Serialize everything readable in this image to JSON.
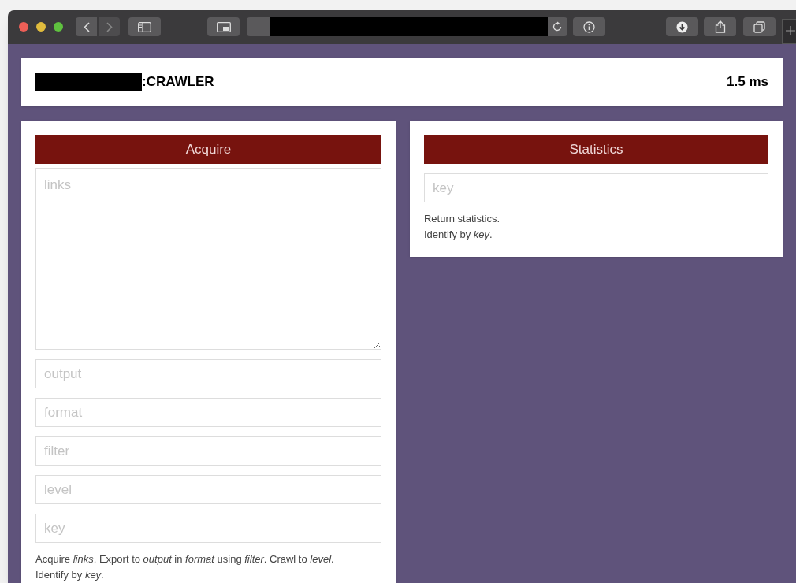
{
  "header": {
    "title": ":CRAWLER",
    "timing": "1.5 ms"
  },
  "panels": [
    {
      "heading": "Acquire",
      "fields": [
        {
          "kind": "textarea",
          "placeholder": "links"
        },
        {
          "kind": "input",
          "placeholder": "output"
        },
        {
          "kind": "input",
          "placeholder": "format"
        },
        {
          "kind": "input",
          "placeholder": "filter"
        },
        {
          "kind": "input",
          "placeholder": "level"
        },
        {
          "kind": "input",
          "placeholder": "key"
        }
      ],
      "description": [
        "Acquire *links*. Export to *output* in *format* using *filter*. Crawl to *level*.",
        "Identify by *key*."
      ]
    },
    {
      "heading": "Statistics",
      "fields": [
        {
          "kind": "input",
          "placeholder": "key"
        }
      ],
      "description": [
        "Return statistics.",
        "Identify by *key*."
      ]
    }
  ]
}
